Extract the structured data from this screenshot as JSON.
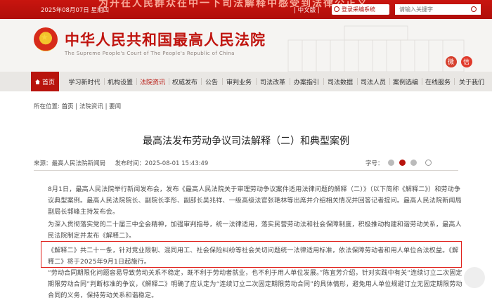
{
  "topbar": {
    "date": "2025年08月07日 星期四",
    "slogan": "为开在人民群众在中一下司法解释中感受到法律公正义",
    "lang": "| 中文版 |",
    "login": "登录采编系统",
    "search_placeholder": "请输入关键字"
  },
  "header": {
    "title": "中华人民共和国最高人民法院",
    "subtitle": "The Supreme People's Court of The People's Republic of China"
  },
  "nav": {
    "items": [
      "首页",
      "学习新时代",
      "机构设置",
      "法院资讯",
      "权威发布",
      "公告",
      "审判业务",
      "司法改革",
      "办案指引",
      "司法数据",
      "司法人员",
      "案例选编",
      "主题教育",
      "在线服务",
      "关于我们"
    ]
  },
  "breadcrumb": {
    "label": "所在位置:",
    "home": "首页",
    "sep": "|",
    "section": "法院资讯",
    "sub": "要闻"
  },
  "article": {
    "title": "最高法发布劳动争议司法解释（二）和典型案例",
    "source": "来源：最高人民法院新闻局",
    "date": "发布时间：2025-08-01 15:43:49",
    "font_label": "字号：",
    "p1": "8月1日，最高人民法院举行新闻发布会，发布《最高人民法院关于审理劳动争议案件适用法律问题的解释（二）》（以下简称《解释二》）和劳动争议典型案例。最高人民法院院长、副院长李彤、副部长吴兆祥、一级高级法官张艳林等出席并介绍相关情况并回答记者提问。最高人民法院新闻局副局长郭峰主持发布会。",
    "p2": "为深入贯彻落实党的二十届三中全会精神，加强审判指导，统一法律适用，落实民营劳动法和社会保障制度，积极推动构建和谐劳动关系，最高人民法院制定并发布《解释二》。",
    "p3": "《解释二》共二十一条，针对竞业限制、混同用工、社会保险纠纷等社会关切问题统一法律适用标准，依法保障劳动者和用人单位合法权益。《解释二》将于2025年9月1日起施行。",
    "p4": "“劳动合同期限化问题容易导致劳动关系不稳定，既不利于劳动者就业，也不利于用人单位发展。”陈宜芳介绍，针对实践中有关“连续订立二次固定期限劳动合同”判断标准的争议，《解释二》明确了应认定为“连续订立二次固定期限劳动合同”的具体情形，避免用人单位规避订立无固定期限劳动合同的义务，保持劳动关系和谐稳定。"
  },
  "colors": {
    "brand_red": "#b8140d",
    "highlight_border": "#e0201a"
  }
}
